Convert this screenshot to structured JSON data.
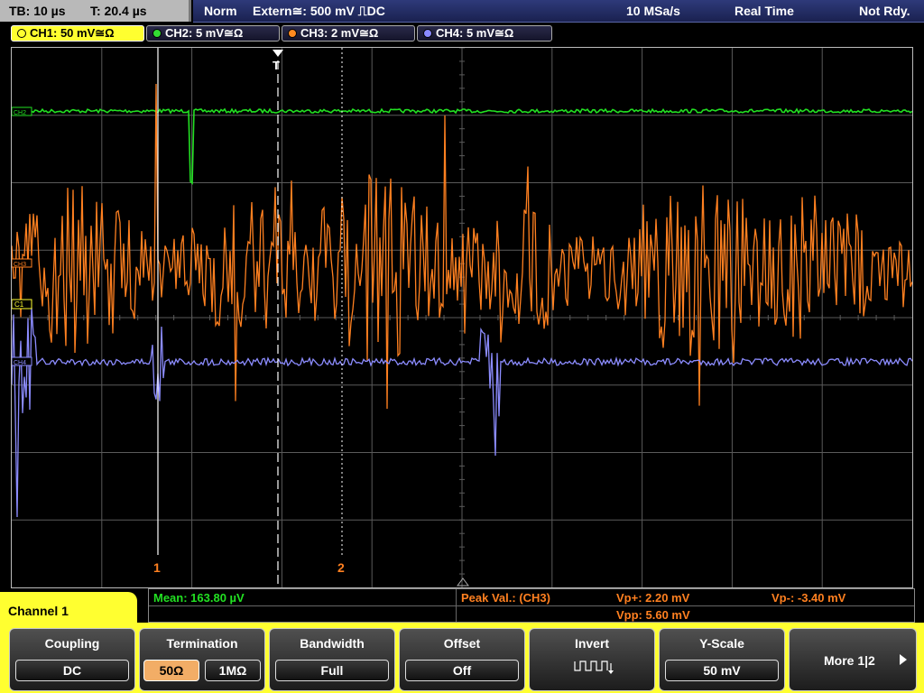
{
  "status": {
    "timebase": "TB: 10 µs",
    "trigger_pos": "T: 20.4 µs",
    "mode": "Norm",
    "trigger_source": "Extern≅: 500 mV ⎍DC",
    "sample_rate": "10 MSa/s",
    "acq_mode": "Real Time",
    "state": "Not Rdy."
  },
  "channels": [
    {
      "label": "CH1: 50 mV≅Ω",
      "color": "#ffff30"
    },
    {
      "label": "CH2: 5 mV≅Ω",
      "color": "#33dd33"
    },
    {
      "label": "CH3: 2 mV≅Ω",
      "color": "#ff8a20"
    },
    {
      "label": "CH4: 5 mV≅Ω",
      "color": "#8a8aff"
    }
  ],
  "trace_colors": {
    "ch2": "#22e022",
    "ch3": "#ff8020",
    "ch4": "#8c8cff",
    "cursor": "#ffffff"
  },
  "cursors": {
    "c1_label": "1",
    "c2_label": "2",
    "trigger_marker": "T"
  },
  "trace_markers": {
    "ch2": "CH2",
    "ch3": "CH3",
    "ch1": "C1",
    "ch4": "CH4"
  },
  "measurements": {
    "mean": "Mean: 163.80 µV",
    "peak_label": "Peak Val.: (CH3)",
    "vp_plus": "Vp+: 2.20 mV",
    "vp_minus": "Vp-: -3.40 mV",
    "vpp": "Vpp: 5.60 mV"
  },
  "menu": {
    "title": "Channel 1",
    "coupling_label": "Coupling",
    "coupling_value": "DC",
    "termination_label": "Termination",
    "term_50": "50Ω",
    "term_1m": "1MΩ",
    "bandwidth_label": "Bandwidth",
    "bandwidth_value": "Full",
    "offset_label": "Offset",
    "offset_value": "Off",
    "invert_label": "Invert",
    "yscale_label": "Y-Scale",
    "yscale_value": "50 mV",
    "more_label": "More 1|2"
  }
}
